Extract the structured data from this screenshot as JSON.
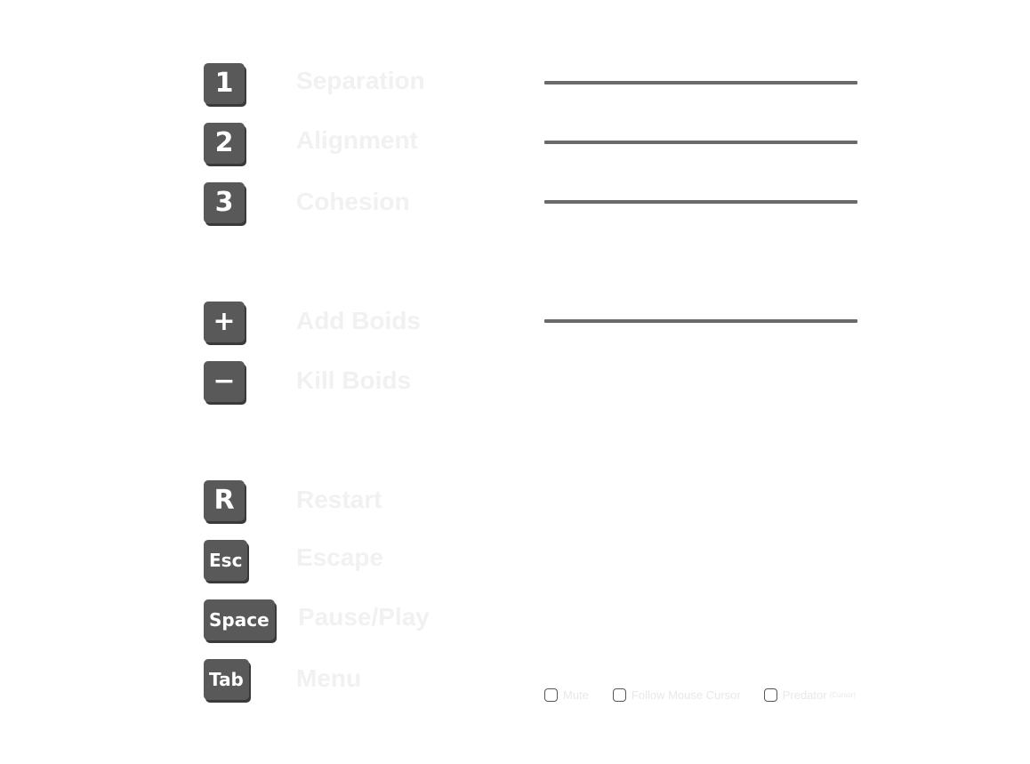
{
  "rules": [
    {
      "key": "1",
      "label": "Separation"
    },
    {
      "key": "2",
      "label": "Alignment"
    },
    {
      "key": "3",
      "label": "Cohesion"
    }
  ],
  "population": [
    {
      "key": "+",
      "label": "Add Boids"
    },
    {
      "key": "−",
      "label": "Kill Boids"
    }
  ],
  "controls": [
    {
      "key": "R",
      "label": "Restart"
    },
    {
      "key": "Esc",
      "label": "Escape"
    },
    {
      "key": "Space",
      "label": "Pause/Play"
    },
    {
      "key": "Tab",
      "label": "Menu"
    }
  ],
  "options": {
    "mute": {
      "label": "Mute",
      "checked": false
    },
    "follow": {
      "label": "Follow Mouse Cursor",
      "checked": false
    },
    "predator": {
      "label": "Predator",
      "note": "(Cursor)",
      "checked": false
    }
  },
  "colors": {
    "key_bg": "#595959",
    "label_text": "#f1f1f1",
    "slider_track": "#6a6a6a"
  }
}
